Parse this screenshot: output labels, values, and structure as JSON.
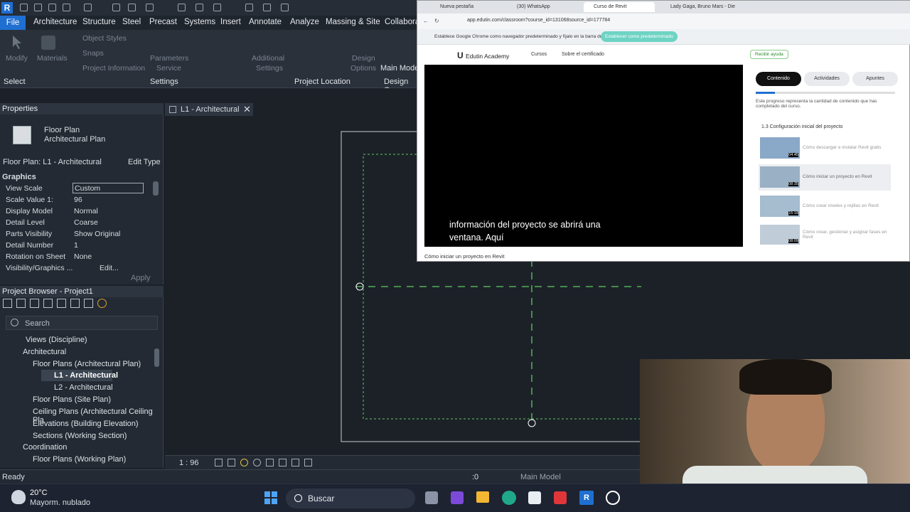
{
  "revit": {
    "tabs": [
      "File",
      "Architecture",
      "Structure",
      "Steel",
      "Precast",
      "Systems",
      "Insert",
      "Annotate",
      "Analyze",
      "Massing & Site",
      "Collabora"
    ],
    "ribbon": {
      "modify": "Modify",
      "materials": "Materials",
      "object_styles": "Object Styles",
      "snaps": "Snaps",
      "project_information": "Project Information",
      "parameters": "Parameters",
      "service": "Service",
      "additional": "Additional",
      "settings_btn": "Settings",
      "design": "Design",
      "options": "Options",
      "main_model": "Main Mode",
      "panel_select": "Select",
      "panel_settings": "Settings",
      "panel_location": "Project Location",
      "panel_design": "Design Op"
    },
    "properties": {
      "title": "Properties",
      "type_name_1": "Floor Plan",
      "type_name_2": "Architectural Plan",
      "instance": "Floor Plan: L1 - Architectural",
      "edit_type": "Edit Type",
      "section": "Graphics",
      "rows": [
        {
          "k": "View Scale",
          "v": "Custom"
        },
        {
          "k": "Scale Value    1:",
          "v": "96"
        },
        {
          "k": "Display Model",
          "v": "Normal"
        },
        {
          "k": "Detail Level",
          "v": "Coarse"
        },
        {
          "k": "Parts Visibility",
          "v": "Show Original"
        },
        {
          "k": "Detail Number",
          "v": "1"
        },
        {
          "k": "Rotation on Sheet",
          "v": "None"
        },
        {
          "k": "Visibility/Graphics ...",
          "v": "Edit..."
        }
      ],
      "apply": "Apply"
    },
    "browser": {
      "title": "Project Browser - Project1",
      "search": "Search",
      "items": [
        {
          "label": "Views (Discipline)",
          "indent": 0
        },
        {
          "label": "Architectural",
          "indent": 1
        },
        {
          "label": "Floor Plans (Architectural Plan)",
          "indent": 2
        },
        {
          "label": "L1 - Architectural",
          "indent": 3
        },
        {
          "label": "L2 - Architectural",
          "indent": 3
        },
        {
          "label": "Floor Plans (Site Plan)",
          "indent": 2
        },
        {
          "label": "Ceiling Plans (Architectural Ceiling Pla",
          "indent": 2
        },
        {
          "label": "Elevations (Building Elevation)",
          "indent": 2
        },
        {
          "label": "Sections (Working Section)",
          "indent": 2
        },
        {
          "label": "Coordination",
          "indent": 1
        },
        {
          "label": "Floor Plans (Working Plan)",
          "indent": 2
        }
      ]
    },
    "view_tab": "L1 - Architectural",
    "scale": "1 : 96",
    "status": "Ready",
    "status_count": ":0",
    "status_model": "Main Model"
  },
  "browser_window": {
    "tabs": [
      "Nueva pestaña",
      "(30) WhatsApp",
      "Curso de Revit",
      "Lady Gaga, Bruno Mars - Die W"
    ],
    "url": "app.edutin.com/classroom?course_id=131068source_id=177784",
    "info_text": "Establece Google Chrome como navegador predeterminado y fíjalo en la barra de tareas",
    "info_button": "Establecer como predeterminado",
    "brand": "Edutin Academy",
    "nav_cursos": "Cursos",
    "nav_cert": "Sobre el certificado",
    "help": "Recibir ayuda",
    "subtitle_1": "información del proyecto se abrirá una",
    "subtitle_2": "ventana. Aquí",
    "video_caption": "Cómo iniciar un proyecto en Revit",
    "side_tabs": [
      "Contenido",
      "Actividades",
      "Apuntes"
    ],
    "progress_text": "Este progreso representa la cantidad de contenido que has completado del curso.",
    "progress": 0.14,
    "section": "1.3  Configuración inicial del proyecto",
    "lessons": [
      {
        "title": "Cómo descargar e instalar Revit gratis",
        "time": "04:45"
      },
      {
        "title": "Cómo iniciar un proyecto en Revit",
        "time": "08:35"
      },
      {
        "title": "Cómo crear niveles y rejillas en Revit",
        "time": "15:18"
      },
      {
        "title": "Cómo crear, gestionar y asignar fases en Revit",
        "time": "08:09"
      }
    ]
  },
  "taskbar": {
    "temp": "20°C",
    "weather": "Mayorm. nublado",
    "search": "Buscar"
  },
  "colors": {
    "revit_blue": "#1f6fd1",
    "green_dash": "#5ec95e",
    "teal": "#6ed3c3"
  }
}
